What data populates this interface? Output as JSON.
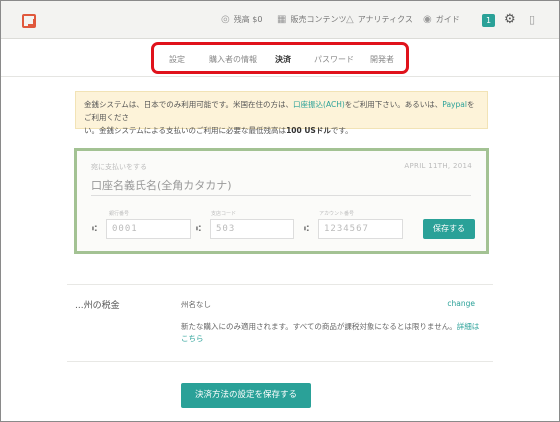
{
  "topbar": {
    "nav": [
      {
        "icon": "coin-icon",
        "glyph": "◎",
        "label": "残高 $0"
      },
      {
        "icon": "calendar-icon",
        "glyph": "▦",
        "label": "販売コンテンツ"
      },
      {
        "icon": "chart-icon",
        "glyph": "△",
        "label": "アナリティクス"
      },
      {
        "icon": "guide-icon",
        "glyph": "◉",
        "label": "ガイド"
      }
    ],
    "notification_count": "1"
  },
  "tabs": [
    {
      "label": "設定",
      "active": false
    },
    {
      "label": "購入者の情報",
      "active": false
    },
    {
      "label": "決済",
      "active": true
    },
    {
      "label": "パスワード",
      "active": false
    },
    {
      "label": "開発者",
      "active": false
    }
  ],
  "notice": {
    "text_before_link": "金銭システムは、日本でのみ利用可能です。米国在住の方は、",
    "ach_link": "口座振込(ACH)",
    "text_mid": "をご利用下さい。あるいは、",
    "paypal_link": "Paypal",
    "text_mid2": "をご利用くださ",
    "line2_before": "い。金銭システムによる支払いのご利用に必要な最低残高は",
    "min_amount": "100 USドル",
    "line2_after": "です。"
  },
  "card": {
    "pay_to_label": "宛に支払いをする",
    "date": "APRIL 11TH, 2014",
    "name_placeholder": "口座名義氏名(全角カタカナ)",
    "bank_code_label": "銀行番号",
    "bank_code_placeholder": "0001",
    "branch_code_label": "支店コード",
    "branch_code_placeholder": "503",
    "account_label": "アカウント番号",
    "account_placeholder": "1234567",
    "save_label": "保存する"
  },
  "tax": {
    "title": "...州の税金",
    "state_value": "州名なし",
    "change_label": "change",
    "desc_before": "新たな購入にのみ適用されます。すべての商品が課税対象になるとは限りません。",
    "desc_link": "詳細はこちら"
  },
  "save_main_label": "決済方法の設定を保存する",
  "colors": {
    "accent": "#2aa198",
    "highlight_border": "#e0121b",
    "card_border": "#a3c293",
    "notice_bg": "#fdf3d9"
  }
}
